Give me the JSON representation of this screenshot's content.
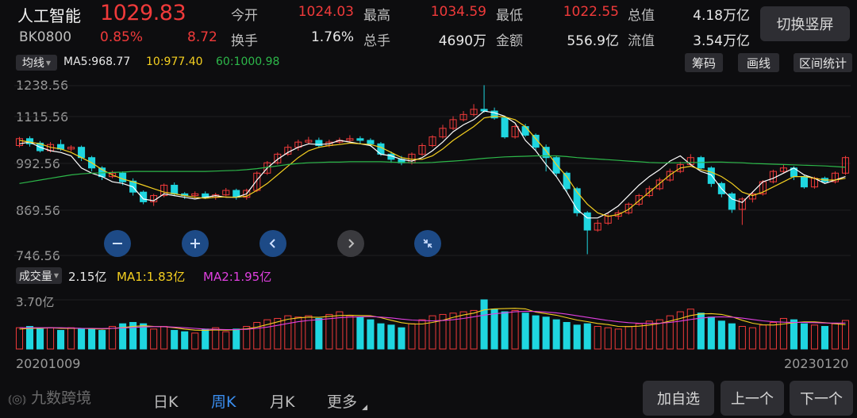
{
  "header": {
    "name": "人工智能",
    "price": "1029.83",
    "code": "BK0800",
    "change_pct": "0.85%",
    "change": "8.72",
    "switch_button": "切换竖屏"
  },
  "quotes": [
    {
      "label": "今开",
      "value": "1024.03",
      "color": "red"
    },
    {
      "label": "最高",
      "value": "1034.59",
      "color": "red"
    },
    {
      "label": "最低",
      "value": "1022.55",
      "color": "red"
    },
    {
      "label": "总值",
      "value": "4.18万亿",
      "color": "white"
    },
    {
      "label": "换手",
      "value": "1.76%",
      "color": "white"
    },
    {
      "label": "总手",
      "value": "4690万",
      "color": "white"
    },
    {
      "label": "金额",
      "value": "556.9亿",
      "color": "white"
    },
    {
      "label": "流值",
      "value": "3.54万亿",
      "color": "white"
    }
  ],
  "indicator_bar": {
    "dropdown": "均线",
    "ma5": "MA5:968.77",
    "ma10": "10:977.40",
    "ma60": "60:1000.98",
    "buttons": [
      "筹码",
      "画线",
      "区间统计"
    ]
  },
  "price_axis": [
    "1238.56",
    "1115.56",
    "992.56",
    "869.56",
    "746.56"
  ],
  "volume_bar": {
    "dropdown": "成交量",
    "value": "2.15亿",
    "ma1": "MA1:1.83亿",
    "ma2": "MA2:1.95亿",
    "axis_top": "3.70亿"
  },
  "dates": {
    "start": "20201009",
    "end": "20230120"
  },
  "bottom_tabs": [
    "日K",
    "周K",
    "月K",
    "更多"
  ],
  "active_tab": "周K",
  "watermark": "九数跨境",
  "bottom_buttons": [
    "加自选",
    "上一个",
    "下一个"
  ],
  "colors": {
    "up": "#f03a3a",
    "down": "#1fd6e0",
    "ma5": "#ffffff",
    "ma10": "#f5d020",
    "ma60": "#2db84a",
    "volma2": "#e040e0"
  },
  "chart_data": {
    "type": "candlestick",
    "ylim": [
      746.56,
      1238.56
    ],
    "ma_series": [
      {
        "name": "MA5",
        "values": [
          1070,
          1075,
          1060,
          1050,
          1045,
          1035,
          1000,
          985,
          975,
          960,
          955,
          945,
          910,
          905,
          925,
          920,
          915,
          910,
          915,
          920,
          915,
          915,
          925,
          965,
          1000,
          1025,
          1045,
          1060,
          1070,
          1068,
          1070,
          1080,
          1075,
          1070,
          1065,
          1040,
          1035,
          1025,
          1020,
          1030,
          1050,
          1075,
          1105,
          1125,
          1140,
          1165,
          1160,
          1150,
          1130,
          1080,
          1050,
          1010,
          975,
          930,
          880,
          855,
          855,
          870,
          890,
          920,
          950,
          975,
          995,
          1020,
          1035,
          1010,
          990,
          980,
          940,
          910,
          900,
          930,
          960,
          970,
          985,
          1000,
          980,
          970,
          955,
          965,
          975
        ]
      },
      {
        "name": "MA10",
        "values": [
          1080,
          1075,
          1070,
          1060,
          1055,
          1045,
          1030,
          1015,
          995,
          980,
          968,
          960,
          950,
          940,
          930,
          925,
          920,
          915,
          912,
          915,
          916,
          915,
          918,
          935,
          955,
          980,
          1005,
          1030,
          1050,
          1060,
          1065,
          1068,
          1072,
          1070,
          1068,
          1060,
          1045,
          1030,
          1025,
          1025,
          1035,
          1055,
          1080,
          1100,
          1120,
          1145,
          1150,
          1148,
          1140,
          1120,
          1085,
          1050,
          1010,
          975,
          930,
          895,
          870,
          860,
          865,
          880,
          905,
          930,
          955,
          980,
          1000,
          1005,
          995,
          988,
          975,
          955,
          930,
          920,
          930,
          945,
          960,
          975,
          975,
          970,
          965,
          965,
          970
        ]
      },
      {
        "name": "MA60",
        "values": [
          955,
          960,
          965,
          970,
          975,
          980,
          983,
          985,
          986,
          987,
          988,
          990,
          990,
          990,
          990,
          990,
          990,
          990,
          990,
          991,
          992,
          993,
          995,
          998,
          1002,
          1006,
          1010,
          1013,
          1015,
          1016,
          1017,
          1017,
          1018,
          1018,
          1018,
          1018,
          1017,
          1016,
          1015,
          1015,
          1016,
          1018,
          1020,
          1022,
          1025,
          1028,
          1030,
          1032,
          1033,
          1034,
          1035,
          1035,
          1035,
          1033,
          1030,
          1028,
          1026,
          1024,
          1022,
          1020,
          1018,
          1016,
          1015,
          1015,
          1015,
          1016,
          1016,
          1017,
          1017,
          1016,
          1015,
          1013,
          1012,
          1011,
          1010,
          1009,
          1008,
          1007,
          1006,
          1004,
          1002
        ]
      }
    ],
    "candles": [
      {
        "o": 1065,
        "c": 1085,
        "h": 1090,
        "l": 1060
      },
      {
        "o": 1085,
        "c": 1070,
        "h": 1092,
        "l": 1062
      },
      {
        "o": 1072,
        "c": 1050,
        "h": 1078,
        "l": 1045
      },
      {
        "o": 1050,
        "c": 1068,
        "h": 1075,
        "l": 1045
      },
      {
        "o": 1068,
        "c": 1055,
        "h": 1082,
        "l": 1050
      },
      {
        "o": 1055,
        "c": 1060,
        "h": 1066,
        "l": 1048
      },
      {
        "o": 1060,
        "c": 1030,
        "h": 1065,
        "l": 1020
      },
      {
        "o": 1030,
        "c": 1000,
        "h": 1035,
        "l": 990
      },
      {
        "o": 1000,
        "c": 975,
        "h": 1005,
        "l": 965
      },
      {
        "o": 975,
        "c": 985,
        "h": 992,
        "l": 970
      },
      {
        "o": 985,
        "c": 960,
        "h": 990,
        "l": 950
      },
      {
        "o": 962,
        "c": 930,
        "h": 970,
        "l": 920
      },
      {
        "o": 930,
        "c": 902,
        "h": 935,
        "l": 895
      },
      {
        "o": 902,
        "c": 920,
        "h": 925,
        "l": 890
      },
      {
        "o": 920,
        "c": 950,
        "h": 955,
        "l": 915
      },
      {
        "o": 950,
        "c": 925,
        "h": 958,
        "l": 920
      },
      {
        "o": 925,
        "c": 920,
        "h": 930,
        "l": 910
      },
      {
        "o": 920,
        "c": 925,
        "h": 932,
        "l": 912
      },
      {
        "o": 925,
        "c": 915,
        "h": 932,
        "l": 910
      },
      {
        "o": 915,
        "c": 922,
        "h": 928,
        "l": 908
      },
      {
        "o": 922,
        "c": 935,
        "h": 942,
        "l": 918
      },
      {
        "o": 935,
        "c": 915,
        "h": 940,
        "l": 908
      },
      {
        "o": 915,
        "c": 935,
        "h": 940,
        "l": 908
      },
      {
        "o": 935,
        "c": 985,
        "h": 990,
        "l": 930
      },
      {
        "o": 985,
        "c": 1015,
        "h": 1020,
        "l": 980
      },
      {
        "o": 1015,
        "c": 1040,
        "h": 1045,
        "l": 1010
      },
      {
        "o": 1040,
        "c": 1060,
        "h": 1068,
        "l": 1035
      },
      {
        "o": 1060,
        "c": 1075,
        "h": 1082,
        "l": 1050
      },
      {
        "o": 1075,
        "c": 1080,
        "h": 1090,
        "l": 1068
      },
      {
        "o": 1080,
        "c": 1065,
        "h": 1088,
        "l": 1058
      },
      {
        "o": 1065,
        "c": 1075,
        "h": 1082,
        "l": 1060
      },
      {
        "o": 1075,
        "c": 1080,
        "h": 1088,
        "l": 1070
      },
      {
        "o": 1080,
        "c": 1085,
        "h": 1095,
        "l": 1075
      },
      {
        "o": 1085,
        "c": 1080,
        "h": 1092,
        "l": 1070
      },
      {
        "o": 1080,
        "c": 1070,
        "h": 1086,
        "l": 1062
      },
      {
        "o": 1070,
        "c": 1040,
        "h": 1075,
        "l": 1035
      },
      {
        "o": 1040,
        "c": 1025,
        "h": 1048,
        "l": 1015
      },
      {
        "o": 1025,
        "c": 1015,
        "h": 1035,
        "l": 1008
      },
      {
        "o": 1015,
        "c": 1040,
        "h": 1045,
        "l": 1010
      },
      {
        "o": 1040,
        "c": 1065,
        "h": 1072,
        "l": 1035
      },
      {
        "o": 1065,
        "c": 1090,
        "h": 1095,
        "l": 1060
      },
      {
        "o": 1090,
        "c": 1115,
        "h": 1125,
        "l": 1085
      },
      {
        "o": 1115,
        "c": 1140,
        "h": 1150,
        "l": 1110
      },
      {
        "o": 1140,
        "c": 1155,
        "h": 1165,
        "l": 1135
      },
      {
        "o": 1155,
        "c": 1170,
        "h": 1185,
        "l": 1150
      },
      {
        "o": 1170,
        "c": 1165,
        "h": 1240,
        "l": 1160
      },
      {
        "o": 1165,
        "c": 1145,
        "h": 1175,
        "l": 1140
      },
      {
        "o": 1145,
        "c": 1090,
        "h": 1150,
        "l": 1085
      },
      {
        "o": 1090,
        "c": 1120,
        "h": 1125,
        "l": 1085
      },
      {
        "o": 1120,
        "c": 1095,
        "h": 1128,
        "l": 1090
      },
      {
        "o": 1095,
        "c": 1060,
        "h": 1100,
        "l": 1050
      },
      {
        "o": 1060,
        "c": 1030,
        "h": 1068,
        "l": 990
      },
      {
        "o": 1030,
        "c": 985,
        "h": 1035,
        "l": 975
      },
      {
        "o": 985,
        "c": 940,
        "h": 990,
        "l": 930
      },
      {
        "o": 940,
        "c": 870,
        "h": 945,
        "l": 860
      },
      {
        "o": 870,
        "c": 820,
        "h": 875,
        "l": 750
      },
      {
        "o": 820,
        "c": 840,
        "h": 850,
        "l": 815
      },
      {
        "o": 840,
        "c": 860,
        "h": 868,
        "l": 835
      },
      {
        "o": 860,
        "c": 870,
        "h": 878,
        "l": 850
      },
      {
        "o": 870,
        "c": 895,
        "h": 900,
        "l": 865
      },
      {
        "o": 895,
        "c": 920,
        "h": 925,
        "l": 890
      },
      {
        "o": 920,
        "c": 940,
        "h": 948,
        "l": 915
      },
      {
        "o": 940,
        "c": 965,
        "h": 972,
        "l": 935
      },
      {
        "o": 965,
        "c": 990,
        "h": 998,
        "l": 960
      },
      {
        "o": 990,
        "c": 1010,
        "h": 1018,
        "l": 985
      },
      {
        "o": 1010,
        "c": 1030,
        "h": 1040,
        "l": 1005
      },
      {
        "o": 1030,
        "c": 1000,
        "h": 1035,
        "l": 995
      },
      {
        "o": 1000,
        "c": 955,
        "h": 1005,
        "l": 945
      },
      {
        "o": 955,
        "c": 925,
        "h": 960,
        "l": 915
      },
      {
        "o": 925,
        "c": 880,
        "h": 930,
        "l": 870
      },
      {
        "o": 880,
        "c": 910,
        "h": 915,
        "l": 835
      },
      {
        "o": 910,
        "c": 925,
        "h": 930,
        "l": 900
      },
      {
        "o": 925,
        "c": 960,
        "h": 965,
        "l": 920
      },
      {
        "o": 960,
        "c": 990,
        "h": 995,
        "l": 955
      },
      {
        "o": 990,
        "c": 1000,
        "h": 1010,
        "l": 985
      },
      {
        "o": 1000,
        "c": 975,
        "h": 1005,
        "l": 965
      },
      {
        "o": 975,
        "c": 945,
        "h": 980,
        "l": 940
      },
      {
        "o": 945,
        "c": 970,
        "h": 975,
        "l": 940
      },
      {
        "o": 970,
        "c": 960,
        "h": 975,
        "l": 955
      },
      {
        "o": 960,
        "c": 985,
        "h": 990,
        "l": 955
      },
      {
        "o": 985,
        "c": 1030,
        "h": 1035,
        "l": 980
      }
    ],
    "volume": {
      "ylim": [
        0,
        3.7
      ],
      "values": [
        1.6,
        1.7,
        1.5,
        1.6,
        1.4,
        1.6,
        1.5,
        1.5,
        1.4,
        1.7,
        1.9,
        2.0,
        1.9,
        1.5,
        1.7,
        1.4,
        1.3,
        1.2,
        1.5,
        1.6,
        1.3,
        1.5,
        1.7,
        2.0,
        2.2,
        2.3,
        2.5,
        2.4,
        2.5,
        2.3,
        2.6,
        2.8,
        2.5,
        2.4,
        2.2,
        1.9,
        1.8,
        1.6,
        1.9,
        2.2,
        2.5,
        2.6,
        2.7,
        2.8,
        2.9,
        3.7,
        3.0,
        2.8,
        2.9,
        2.7,
        2.5,
        2.4,
        2.2,
        2.0,
        1.8,
        1.9,
        1.7,
        1.6,
        1.5,
        1.7,
        1.9,
        2.1,
        2.2,
        2.5,
        2.8,
        3.0,
        2.7,
        2.4,
        2.1,
        1.9,
        1.7,
        1.6,
        1.8,
        2.0,
        2.3,
        2.2,
        1.9,
        1.8,
        1.7,
        1.9,
        2.15
      ],
      "ma1": [
        1.5,
        1.55,
        1.55,
        1.6,
        1.55,
        1.55,
        1.55,
        1.52,
        1.5,
        1.55,
        1.62,
        1.7,
        1.75,
        1.7,
        1.68,
        1.6,
        1.5,
        1.42,
        1.4,
        1.44,
        1.42,
        1.45,
        1.52,
        1.65,
        1.84,
        2.04,
        2.24,
        2.34,
        2.4,
        2.38,
        2.46,
        2.52,
        2.54,
        2.52,
        2.5,
        2.36,
        2.16,
        1.98,
        1.88,
        1.88,
        2.0,
        2.16,
        2.38,
        2.56,
        2.7,
        2.94,
        3.02,
        3.04,
        3.06,
        3.02,
        2.78,
        2.66,
        2.54,
        2.36,
        2.18,
        2.06,
        1.92,
        1.84,
        1.7,
        1.68,
        1.72,
        1.8,
        1.92,
        2.1,
        2.3,
        2.52,
        2.64,
        2.66,
        2.6,
        2.42,
        2.16,
        1.94,
        1.82,
        1.8,
        1.88,
        1.98,
        2.04,
        2.04,
        1.98,
        1.9,
        1.83
      ],
      "ma2": [
        1.6,
        1.6,
        1.6,
        1.6,
        1.6,
        1.58,
        1.56,
        1.55,
        1.54,
        1.56,
        1.58,
        1.62,
        1.66,
        1.68,
        1.68,
        1.65,
        1.6,
        1.55,
        1.5,
        1.48,
        1.46,
        1.46,
        1.48,
        1.55,
        1.65,
        1.78,
        1.92,
        2.05,
        2.15,
        2.2,
        2.28,
        2.35,
        2.4,
        2.42,
        2.44,
        2.4,
        2.34,
        2.25,
        2.18,
        2.14,
        2.12,
        2.14,
        2.2,
        2.3,
        2.42,
        2.55,
        2.65,
        2.72,
        2.8,
        2.84,
        2.82,
        2.78,
        2.72,
        2.62,
        2.5,
        2.38,
        2.26,
        2.15,
        2.05,
        1.98,
        1.94,
        1.92,
        1.94,
        2.0,
        2.1,
        2.22,
        2.32,
        2.4,
        2.42,
        2.4,
        2.32,
        2.22,
        2.12,
        2.05,
        2.02,
        2.0,
        2.0,
        1.98,
        1.96,
        1.95,
        1.95
      ]
    }
  }
}
